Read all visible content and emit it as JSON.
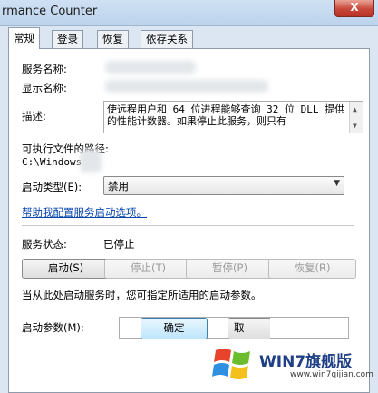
{
  "window": {
    "title": "rmance Counter",
    "close_label": "X"
  },
  "tabs": [
    {
      "label": "常规",
      "active": true
    },
    {
      "label": "登录",
      "active": false
    },
    {
      "label": "恢复",
      "active": false
    },
    {
      "label": "依存关系",
      "active": false
    }
  ],
  "general": {
    "service_name_label": "服务名称:",
    "display_name_label": "显示名称:",
    "description_label": "描述:",
    "description_text": "使远程用户和 64 位进程能够查询 32 位 DLL 提供的性能计数器。如果停止此服务，则只有",
    "exe_path_label": "可执行文件的路径:",
    "exe_path_value": "C:\\Windows",
    "startup_type_label": "启动类型(E):",
    "startup_type_value": "禁用",
    "help_link": "帮助我配置服务启动选项。",
    "service_status_label": "服务状态:",
    "service_status_value": "已停止",
    "buttons": {
      "start": "启动(S)",
      "stop": "停止(T)",
      "pause": "暂停(P)",
      "resume": "恢复(R)"
    },
    "hint_text": "当从此处启动服务时，您可指定所适用的启动参数。",
    "start_params_label": "启动参数(M):",
    "start_params_value": ""
  },
  "footer": {
    "ok": "确定",
    "next_partial": "取"
  },
  "watermark": {
    "text": "WIN7旗舰版",
    "url": "www.win7qijian.com"
  }
}
